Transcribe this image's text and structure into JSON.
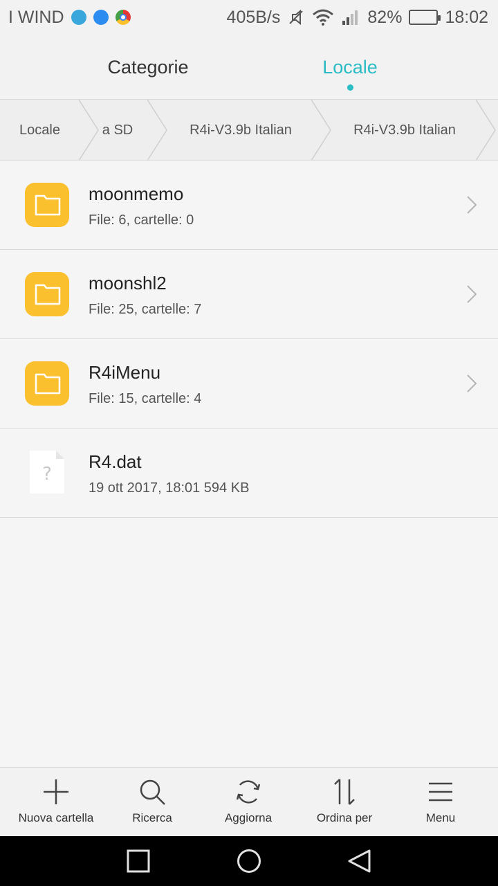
{
  "status_bar": {
    "carrier": "I WIND",
    "net_speed": "405B/s",
    "battery": "82%",
    "battery_level": 0.82,
    "time": "18:02",
    "icons": [
      "telegram-icon",
      "messenger-icon",
      "chrome-icon",
      "mute-icon",
      "wifi-icon",
      "signal-icon",
      "battery-icon"
    ]
  },
  "tabs": [
    {
      "label": "Categorie",
      "active": false
    },
    {
      "label": "Locale",
      "active": true
    }
  ],
  "breadcrumb": [
    "Locale",
    "a SD",
    "R4i-V3.9b Italian",
    "R4i-V3.9b Italian"
  ],
  "items": [
    {
      "type": "folder",
      "name": "moonmemo",
      "detail": "File: 6, cartelle: 0"
    },
    {
      "type": "folder",
      "name": "moonshl2",
      "detail": "File: 25, cartelle: 7"
    },
    {
      "type": "folder",
      "name": "R4iMenu",
      "detail": "File: 15, cartelle: 4"
    },
    {
      "type": "file",
      "name": "R4.dat",
      "detail": "19 ott 2017, 18:01 594 KB"
    }
  ],
  "toolbar": {
    "new_folder": "Nuova cartella",
    "search": "Ricerca",
    "refresh": "Aggiorna",
    "sort": "Ordina per",
    "menu": "Menu"
  },
  "colors": {
    "accent": "#2bbcc4",
    "folder": "#fbc02d",
    "background": "#f5f5f5"
  }
}
